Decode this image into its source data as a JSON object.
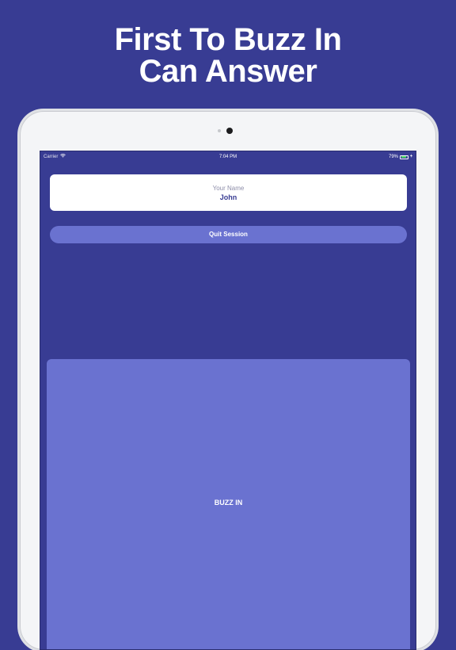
{
  "headline": {
    "line1": "First To Buzz In",
    "line2": "Can Answer"
  },
  "status_bar": {
    "carrier": "Carrier",
    "time": "7:04 PM",
    "battery_percent": "79%",
    "battery_level": 0.79,
    "icons": [
      "wifi-icon",
      "battery-icon",
      "charging-icon"
    ]
  },
  "name_card": {
    "label": "Your Name",
    "value": "John"
  },
  "buttons": {
    "quit_label": "Quit Session",
    "buzz_label": "BUZZ IN"
  },
  "colors": {
    "background": "#383c93",
    "button": "#6a72d0",
    "name_text": "#383c93",
    "label_text": "#8e8ea9",
    "device_frame": "#f4f5f7"
  }
}
